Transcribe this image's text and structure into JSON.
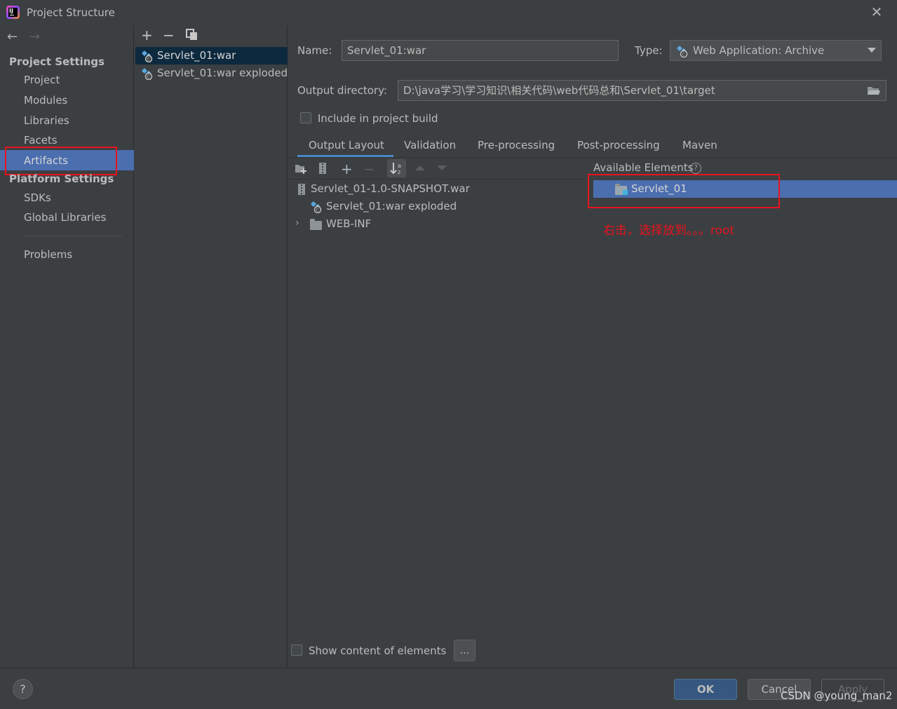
{
  "window": {
    "title": "Project Structure"
  },
  "sidebar": {
    "project_settings_header": "Project Settings",
    "project_items": [
      "Project",
      "Modules",
      "Libraries",
      "Facets",
      "Artifacts"
    ],
    "platform_settings_header": "Platform Settings",
    "platform_items": [
      "SDKs",
      "Global Libraries"
    ],
    "problems": "Problems",
    "selected": "Artifacts"
  },
  "artifacts": {
    "items": [
      "Servlet_01:war",
      "Servlet_01:war exploded"
    ],
    "selected": "Servlet_01:war"
  },
  "form": {
    "name_label": "Name:",
    "name_value": "Servlet_01:war",
    "type_label": "Type:",
    "type_value": "Web Application: Archive",
    "output_label": "Output directory:",
    "output_value": "D:\\java学习\\学习知识\\相关代码\\web代码总和\\Servlet_01\\target",
    "include_label": "Include in project build",
    "include_checked": false
  },
  "tabs": [
    "Output Layout",
    "Validation",
    "Pre-processing",
    "Post-processing",
    "Maven"
  ],
  "active_tab": "Output Layout",
  "layout_tree": {
    "root": "Servlet_01-1.0-SNAPSHOT.war",
    "child": "Servlet_01:war exploded",
    "folder": "WEB-INF"
  },
  "available": {
    "header": "Available Elements",
    "items": [
      "Servlet_01"
    ]
  },
  "annotation": "右击，选择放到。。。root",
  "show_content_label": "Show content of elements",
  "dots_label": "...",
  "buttons": {
    "ok": "OK",
    "cancel": "Cancel",
    "apply": "Apply",
    "help": "?"
  },
  "watermark": "CSDN @young_man2",
  "colors": {
    "selection": "#4b6eaf",
    "annotation": "#e8131f",
    "tab_underline": "#4a88c7"
  }
}
